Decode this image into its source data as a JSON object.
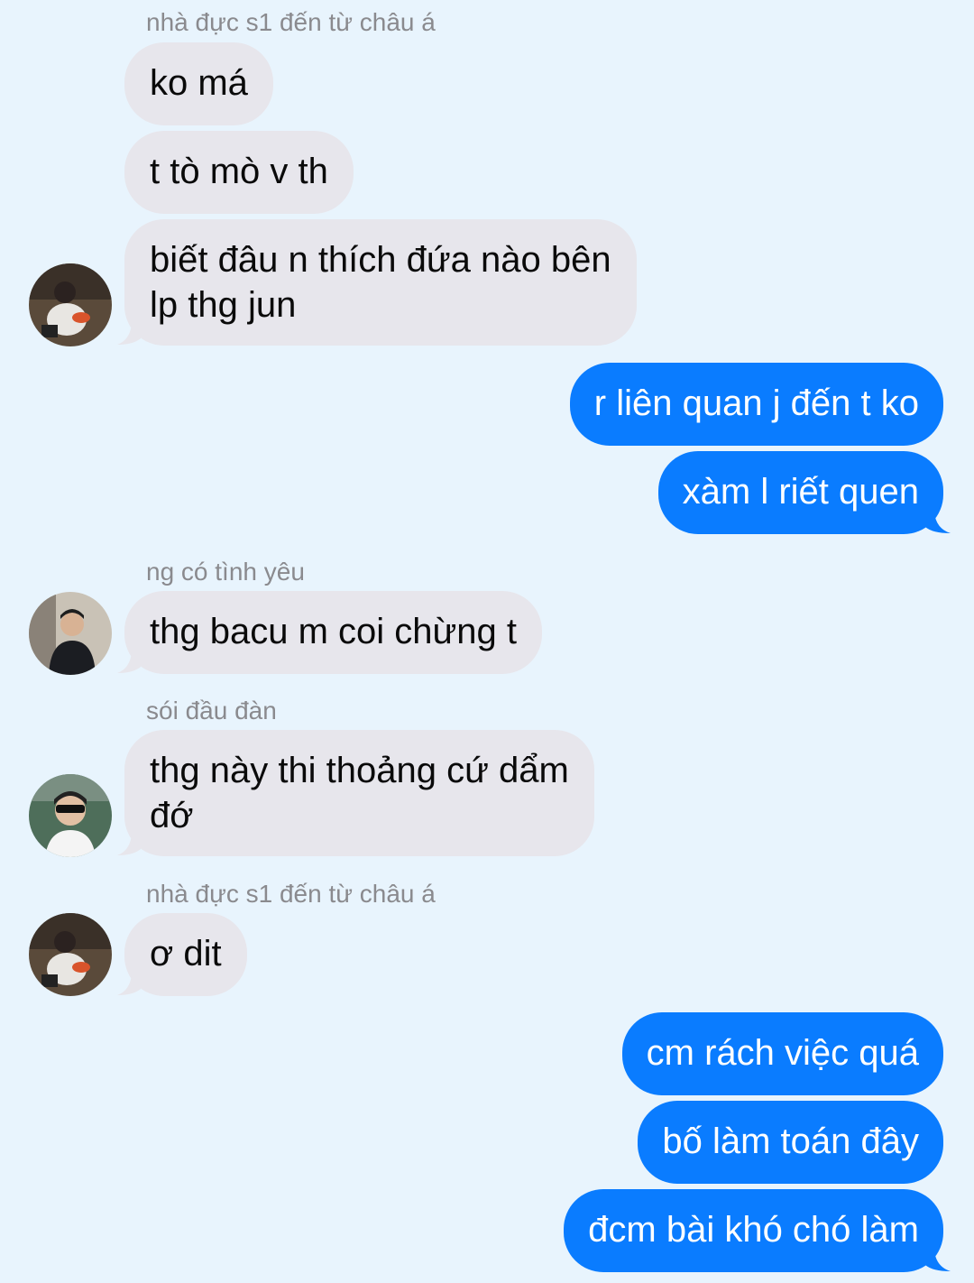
{
  "conversation": {
    "groups": [
      {
        "sender": "nhà đực s1 đến từ châu á",
        "messages": [
          "ko má",
          "t tò mò v th",
          "biết đâu n thích đứa nào bên",
          "lp thg jun"
        ]
      },
      {
        "outgoing": [
          "r liên quan j đến t ko",
          "xàm l riết quen"
        ]
      },
      {
        "sender": "ng có tình yêu",
        "messages": [
          "thg bacu m coi chừng t"
        ]
      },
      {
        "sender": "sói đầu đàn",
        "messages": [
          "thg này thi thoảng cứ dẩm",
          "đớ"
        ]
      },
      {
        "sender": "nhà đực s1 đến từ châu á",
        "messages": [
          "ơ dit"
        ]
      },
      {
        "outgoing": [
          "cm rách việc quá",
          "bố làm toán đây",
          "đcm bài khó chó làm"
        ]
      }
    ]
  },
  "colors": {
    "background": "#e8f4fd",
    "incoming_bubble": "#e7e6ec",
    "outgoing_bubble": "#0a7cff",
    "sender_name": "#8a8a8e"
  },
  "avatars": [
    "avatar-person-eating",
    "avatar-person-black-hoodie",
    "avatar-person-sunglasses",
    "avatar-person-eating"
  ]
}
